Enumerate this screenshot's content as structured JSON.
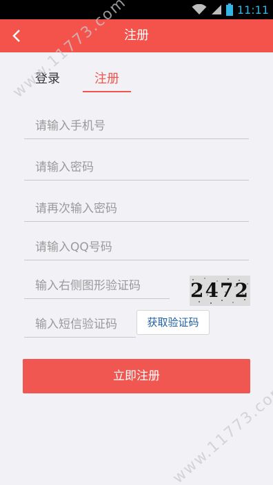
{
  "status_bar": {
    "time": "11:11",
    "icons": [
      "wifi-icon",
      "signal-icon",
      "battery-icon"
    ]
  },
  "app_bar": {
    "title": "注册",
    "back_icon": "chevron-left-icon"
  },
  "tabs": [
    {
      "label": "登录",
      "active": false
    },
    {
      "label": "注册",
      "active": true
    }
  ],
  "form": {
    "phone_placeholder": "请输入手机号",
    "password_placeholder": "请输入密码",
    "confirm_password_placeholder": "请再次输入密码",
    "qq_placeholder": "请输入QQ号码",
    "captcha_placeholder": "输入右侧图形验证码",
    "captcha_code": "2472",
    "sms_placeholder": "输入短信验证码",
    "get_code_label": "获取验证码",
    "submit_label": "立即注册"
  },
  "watermark": {
    "text": "www.11773.com"
  },
  "colors": {
    "accent": "#f4534c",
    "button": "#ef5750",
    "link_blue": "#1f5fa8",
    "background": "#f2f2f6",
    "status_time": "#33b5e5"
  }
}
